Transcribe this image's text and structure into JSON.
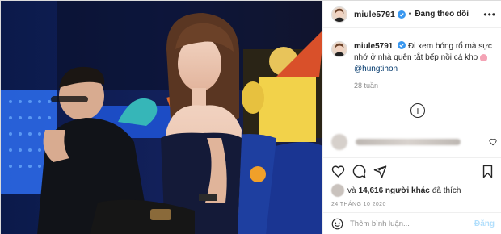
{
  "header": {
    "username": "miule5791",
    "follow_status": "Đang theo dõi",
    "separator": "•",
    "more_icon": "more-horizontal-icon"
  },
  "caption": {
    "username": "miule5791",
    "text": "Đi xem bóng rổ mà sực nhớ ở nhà quên tắt bếp nồi cá kho",
    "mention": "@hungtihon",
    "age": "28 tuần"
  },
  "load_more": {
    "symbol": "+"
  },
  "actions": {
    "like_icon": "heart-outline-icon",
    "comment_icon": "comment-icon",
    "share_icon": "paper-plane-icon",
    "save_icon": "bookmark-icon",
    "likes_prefix": "và",
    "likes_count": "14,616 người khác",
    "likes_suffix": "đã thích",
    "date": "24 THÁNG 10 2020"
  },
  "add_comment": {
    "placeholder": "Thêm bình luận...",
    "post_label": "Đăng"
  },
  "colors": {
    "verified": "#3897f0",
    "text": "#262626",
    "muted": "#8e8e8e",
    "mention": "#00376b",
    "post_disabled": "#b2dffc"
  }
}
